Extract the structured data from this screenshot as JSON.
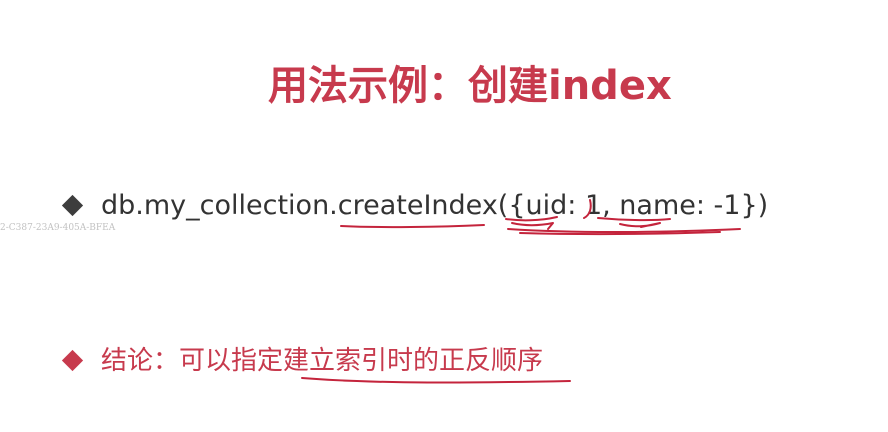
{
  "slide": {
    "title": "用法示例：创建index"
  },
  "bullets": [
    {
      "marker_icon": "diamond-bullet-icon",
      "marker_color": "#3d3d3d",
      "text": "db.my_collection.createIndex({uid: 1, name: -1})"
    },
    {
      "marker_icon": "diamond-bullet-icon",
      "marker_color": "#c73a4d",
      "text": "结论：可以指定建立索引时的正反顺序"
    }
  ],
  "watermark": {
    "text": "2-C387-23A9-405A-BFEA"
  },
  "colors": {
    "accent": "#c73a4d",
    "body_text": "#333333",
    "pen_annotation": "#c4243c"
  }
}
